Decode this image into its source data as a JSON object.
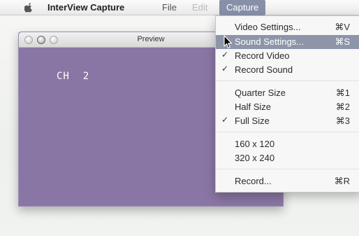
{
  "menubar": {
    "app_name": "InterView Capture",
    "file": "File",
    "edit": "Edit",
    "capture": "Capture"
  },
  "window": {
    "title": "Preview",
    "channel_overlay": "CH  2"
  },
  "capture_menu": {
    "items": [
      {
        "label": "Video Settings...",
        "shortcut": "⌘V",
        "checked": false,
        "highlighted": false
      },
      {
        "label": "Sound Settings...",
        "shortcut": "⌘S",
        "checked": false,
        "highlighted": true
      },
      {
        "label": "Record Video",
        "shortcut": "",
        "checked": true,
        "highlighted": false
      },
      {
        "label": "Record Sound",
        "shortcut": "",
        "checked": true,
        "highlighted": false
      },
      {
        "label": "Quarter Size",
        "shortcut": "⌘1",
        "checked": false,
        "highlighted": false
      },
      {
        "label": "Half Size",
        "shortcut": "⌘2",
        "checked": false,
        "highlighted": false
      },
      {
        "label": "Full Size",
        "shortcut": "⌘3",
        "checked": true,
        "highlighted": false
      },
      {
        "label": "160 x 120",
        "shortcut": "",
        "checked": false,
        "highlighted": false
      },
      {
        "label": "320 x 240",
        "shortcut": "",
        "checked": false,
        "highlighted": false
      },
      {
        "label": "Record...",
        "shortcut": "⌘R",
        "checked": false,
        "highlighted": false
      }
    ],
    "check_glyph": "✓"
  },
  "colors": {
    "preview_background": "#8a76a4",
    "menu_highlight": "#8e95a9",
    "menubar_active": "#8790a8"
  },
  "icons": {
    "apple": "apple-icon",
    "cursor": "arrow-cursor-icon"
  }
}
